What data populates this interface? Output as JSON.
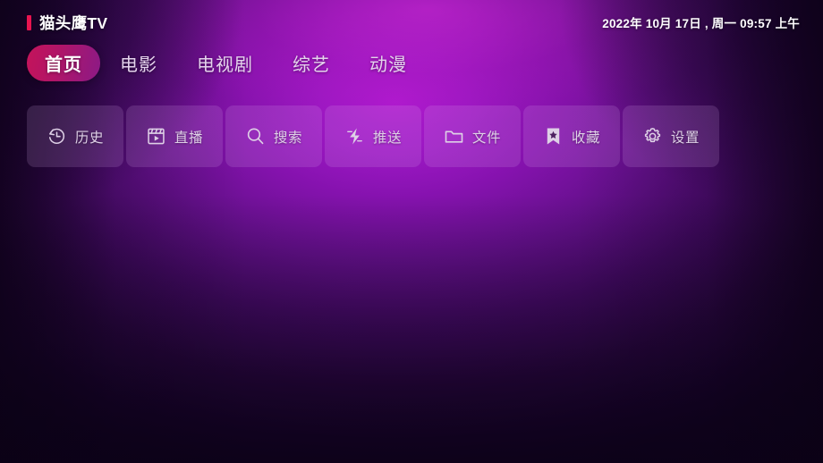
{
  "header": {
    "brand_marker": "brand-marker",
    "brand_title": "猫头鹰TV",
    "datetime": "2022年 10月 17日 , 周一 09:57 上午"
  },
  "nav": {
    "tabs": [
      {
        "label": "首页",
        "active": true
      },
      {
        "label": "电影",
        "active": false
      },
      {
        "label": "电视剧",
        "active": false
      },
      {
        "label": "综艺",
        "active": false
      },
      {
        "label": "动漫",
        "active": false
      }
    ]
  },
  "quick_actions": [
    {
      "label": "历史",
      "icon": "history-clock-icon"
    },
    {
      "label": "直播",
      "icon": "live-play-frame-icon"
    },
    {
      "label": "搜索",
      "icon": "search-icon"
    },
    {
      "label": "推送",
      "icon": "lightning-push-icon"
    },
    {
      "label": "文件",
      "icon": "folder-icon"
    },
    {
      "label": "收藏",
      "icon": "bookmark-star-icon"
    },
    {
      "label": "设置",
      "icon": "gear-icon"
    }
  ],
  "colors": {
    "accent_marker": "#e8144f",
    "tab_active_start": "#c4145a",
    "tab_active_end": "#8c1a86",
    "background_core": "#b41ad6",
    "background_edge": "#140326",
    "card_surface": "rgba(226,180,245,0.16)",
    "text_primary": "#ffffff",
    "text_muted": "#ded0e6"
  }
}
